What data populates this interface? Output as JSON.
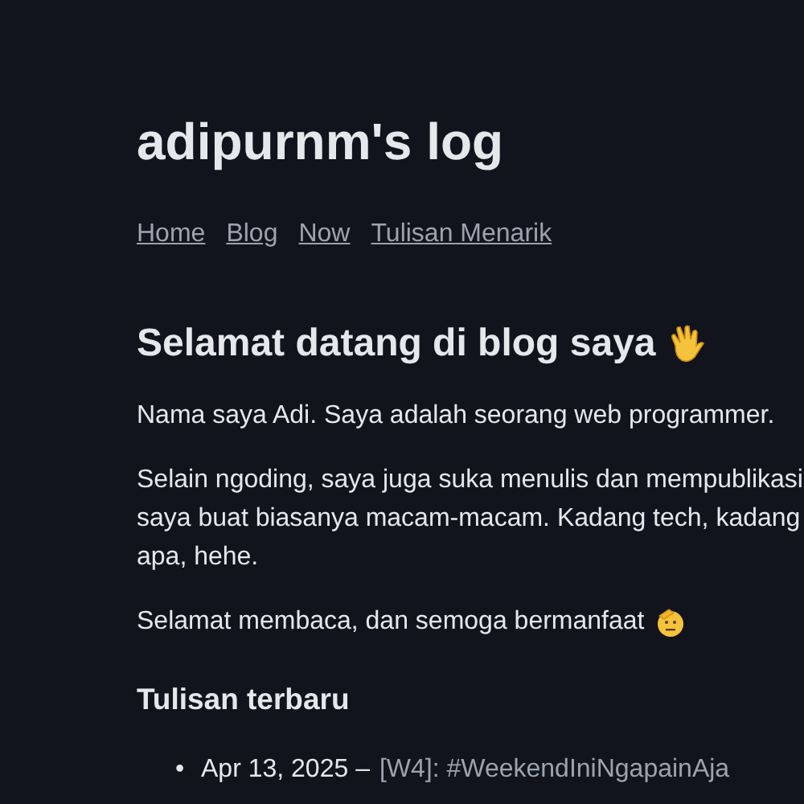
{
  "site_title": "adipurnm's log",
  "nav": [
    {
      "label": "Home"
    },
    {
      "label": "Blog"
    },
    {
      "label": "Now"
    },
    {
      "label": "Tulisan Menarik"
    }
  ],
  "heading": "Selamat datang di blog saya",
  "paragraphs": [
    {
      "lines": [
        "Nama saya Adi. Saya adalah seorang web programmer."
      ]
    },
    {
      "lines": [
        "Selain ngoding, saya juga suka menulis dan mempublikasi",
        "saya buat biasanya macam-macam. Kadang tech, kadang",
        "apa, hehe."
      ]
    },
    {
      "lines": [
        "Selamat membaca, dan semoga bermanfaat"
      ],
      "kind": "with_icon"
    }
  ],
  "recent_heading": "Tulisan terbaru",
  "posts": [
    {
      "bullet": "•",
      "date": "Apr 13, 2025 –",
      "title": "[W4]: #WeekendIniNgapainAja"
    }
  ]
}
